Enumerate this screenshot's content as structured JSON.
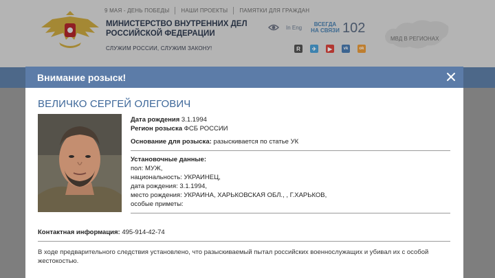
{
  "header": {
    "top_links": [
      "9 МАЯ - ДЕНЬ ПОБЕДЫ",
      "НАШИ ПРОЕКТЫ",
      "ПАМЯТКИ ДЛЯ ГРАЖДАН"
    ],
    "title_line1": "МИНИСТЕРСТВО ВНУТРЕННИХ ДЕЛ",
    "title_line2": "РОССИЙСКОЙ ФЕДЕРАЦИИ",
    "slogan": "СЛУЖИМ РОССИИ, СЛУЖИМ ЗАКОНУ!",
    "lang": "In Eng",
    "hotline_label_line1": "ВСЕГДА",
    "hotline_label_line2": "НА СВЯЗИ",
    "hotline_number": "102",
    "map_label": "МВД В РЕГИОНАХ",
    "social_icons": [
      "rutube-icon",
      "telegram-icon",
      "youtube-icon",
      "vk-icon",
      "ok-icon"
    ],
    "social_letters": [
      "R",
      "✈",
      "▶",
      "vk",
      "ok"
    ],
    "colors": {
      "nav": "#5e7fa8",
      "accent": "#4a80b0"
    }
  },
  "modal": {
    "title": "Внимание розыск!",
    "name": "ВЕЛИЧКО СЕРГЕЙ ОЛЕГОВИЧ",
    "birth_label": "Дата рождения",
    "birth_value": "3.1.1994",
    "region_label": "Регион розыска",
    "region_value": "ФСБ РОССИИ",
    "basis_label": "Основание для розыска",
    "basis_value": "разыскивается по статье УК",
    "details_label": "Установочные данные:",
    "details": [
      "пол: МУЖ,",
      "национальность: УКРАИНЕЦ,",
      "дата рождения: 3.1.1994,",
      "место рождения: УКРАИНА, ХАРЬКОВСКАЯ ОБЛ., , Г.ХАРЬКОВ,",
      "особые приметы:"
    ],
    "contact_label": "Контактная информация:",
    "contact_value": "495-914-42-74",
    "description": "В ходе предварительного следствия установлено, что разыскиваемый пытал российских военнослужащих и убивал их с особой жестокостью."
  }
}
